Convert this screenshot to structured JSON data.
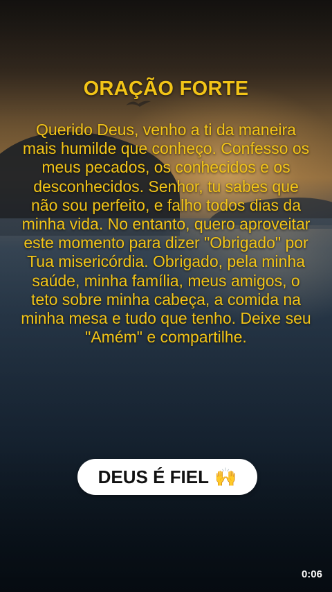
{
  "title": "ORAÇÃO FORTE",
  "prayer_text": "Querido Deus, venho a ti da maneira mais humilde que conheço. Confesso os meus pecados, os conhecidos e os desconhecidos. Senhor, tu sabes que não sou perfeito, e falho todos dias da minha vida. No entanto, quero aproveitar este momento para dizer \"Obrigado\" por Tua misericórdia. Obrigado, pela minha saúde, minha família, meus amigos, o teto sobre minha cabeça, a comida na minha mesa e tudo que tenho. Deixe seu \"Amém\" e compartilhe.",
  "button": {
    "label": "DEUS É FIEL",
    "icon": "raising-hands-icon",
    "emoji": "🙌"
  },
  "timestamp": "0:06",
  "colors": {
    "text_accent": "#f2c417",
    "pill_bg": "#ffffff",
    "pill_text": "#111111"
  }
}
